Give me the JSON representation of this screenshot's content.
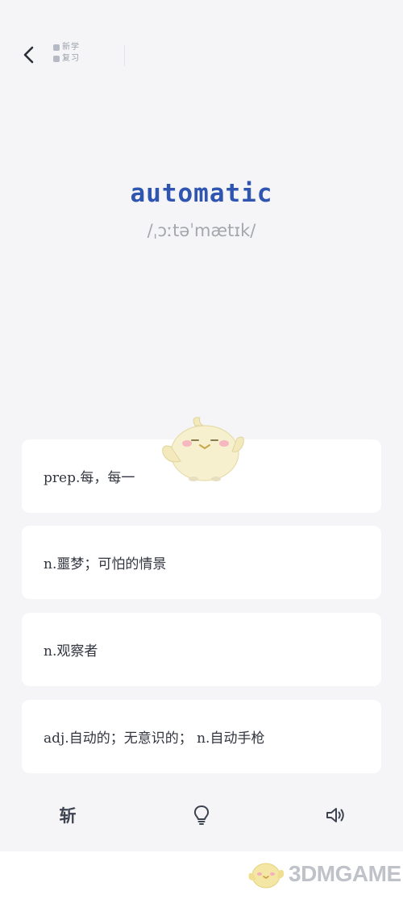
{
  "header": {
    "back_icon": "chevron-left-icon",
    "new_label": "新学",
    "review_label": "复习"
  },
  "word": {
    "text": "automatic",
    "phonetic": "/ˌɔːtəˈmætɪk/"
  },
  "definitions": [
    "prep.每，每一",
    "n.噩梦；可怕的情景",
    "n.观察者",
    "adj.自动的；无意识的； n.自动手枪"
  ],
  "toolbar": {
    "skip_label": "斩",
    "hint_icon": "lightbulb-icon",
    "audio_icon": "speaker-icon"
  },
  "watermark": {
    "text": "3DMGAME"
  },
  "colors": {
    "accent": "#2f55b0",
    "phonetic": "#a4a7ae",
    "background": "#f5f5f7",
    "card": "#ffffff"
  }
}
